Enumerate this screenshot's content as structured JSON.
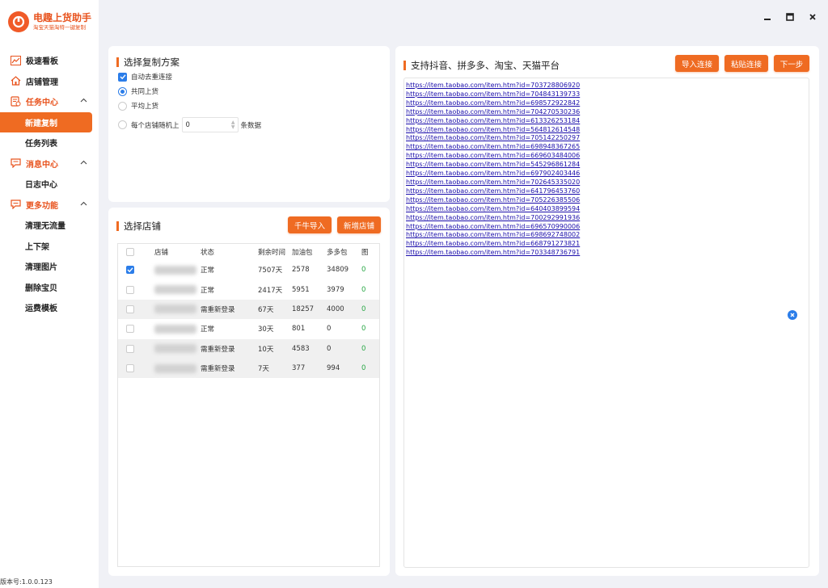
{
  "app": {
    "title": "电趣上货助手",
    "subtitle": "淘宝天猫淘特一键复制",
    "version": "版本号:1.0.0.123"
  },
  "window": {
    "minimize": "—",
    "maximize": "□",
    "close": "×"
  },
  "sidebar": {
    "items": [
      {
        "label": "极速看板",
        "icon": "chart-icon"
      },
      {
        "label": "店铺管理",
        "icon": "home-icon"
      },
      {
        "label": "任务中心",
        "icon": "task-icon",
        "expandable": true
      },
      {
        "label": "新建复制",
        "sub": true,
        "active": true
      },
      {
        "label": "任务列表",
        "sub": true
      },
      {
        "label": "消息中心",
        "icon": "message-icon",
        "expandable": true
      },
      {
        "label": "日志中心",
        "sub": true
      },
      {
        "label": "更多功能",
        "icon": "more-icon",
        "expandable": true
      },
      {
        "label": "清理无流量",
        "sub": true
      },
      {
        "label": "上下架",
        "sub": true
      },
      {
        "label": "清理图片",
        "sub": true
      },
      {
        "label": "删除宝贝",
        "sub": true
      },
      {
        "label": "运费模板",
        "sub": true
      }
    ]
  },
  "plan": {
    "title": "选择复制方案",
    "dedupe": {
      "label": "自动去重连接",
      "checked": true
    },
    "shared": {
      "label": "共同上货",
      "selected": true
    },
    "average": {
      "label": "平均上货",
      "selected": false
    },
    "random": {
      "label_before": "每个店铺随机上",
      "value": "0",
      "label_after": "条数据"
    }
  },
  "shops": {
    "title": "选择店铺",
    "import_btn": "千牛导入",
    "add_btn": "新增店铺",
    "columns": [
      "店铺",
      "状态",
      "剩余时间",
      "加油包",
      "多多包",
      "图"
    ],
    "rows": [
      {
        "checked": true,
        "status": "正常",
        "remaining": "7507天",
        "fuel": "2578",
        "duoduo": "34809",
        "extra": "0"
      },
      {
        "checked": false,
        "status": "正常",
        "remaining": "2417天",
        "fuel": "5951",
        "duoduo": "3979",
        "extra": "0"
      },
      {
        "checked": false,
        "status": "需重新登录",
        "remaining": "67天",
        "fuel": "18257",
        "duoduo": "4000",
        "extra": "0"
      },
      {
        "checked": false,
        "status": "正常",
        "remaining": "30天",
        "fuel": "801",
        "duoduo": "0",
        "extra": "0"
      },
      {
        "checked": false,
        "status": "需重新登录",
        "remaining": "10天",
        "fuel": "4583",
        "duoduo": "0",
        "extra": "0"
      },
      {
        "checked": false,
        "status": "需重新登录",
        "remaining": "7天",
        "fuel": "377",
        "duoduo": "994",
        "extra": "0"
      }
    ]
  },
  "links": {
    "title": "支持抖音、拼多多、淘宝、天猫平台",
    "import_btn": "导入连接",
    "paste_btn": "粘贴连接",
    "next_btn": "下一步",
    "urls": [
      "https://item.taobao.com/item.htm?id=703728806920",
      "https://item.taobao.com/item.htm?id=704843139733",
      "https://item.taobao.com/item.htm?id=698572922842",
      "https://item.taobao.com/item.htm?id=704270530236",
      "https://item.taobao.com/item.htm?id=613326253184",
      "https://item.taobao.com/item.htm?id=564812614548",
      "https://item.taobao.com/item.htm?id=705142250297",
      "https://item.taobao.com/item.htm?id=698948367265",
      "https://item.taobao.com/item.htm?id=669603484006",
      "https://item.taobao.com/item.htm?id=545296861284",
      "https://item.taobao.com/item.htm?id=697902403446",
      "https://item.taobao.com/item.htm?id=702645335020",
      "https://item.taobao.com/item.htm?id=641796453760",
      "https://item.taobao.com/item.htm?id=705226385506",
      "https://item.taobao.com/item.htm?id=640403899594",
      "https://item.taobao.com/item.htm?id=700292991936",
      "https://item.taobao.com/item.htm?id=696570990006",
      "https://item.taobao.com/item.htm?id=698692748002",
      "https://item.taobao.com/item.htm?id=668791273821",
      "https://item.taobao.com/item.htm?id=703348736791"
    ]
  },
  "colors": {
    "accent": "#ef6b22",
    "brand": "#e8531e",
    "link": "#1a0dab",
    "check": "#2b7de9",
    "ok": "#28a745"
  }
}
